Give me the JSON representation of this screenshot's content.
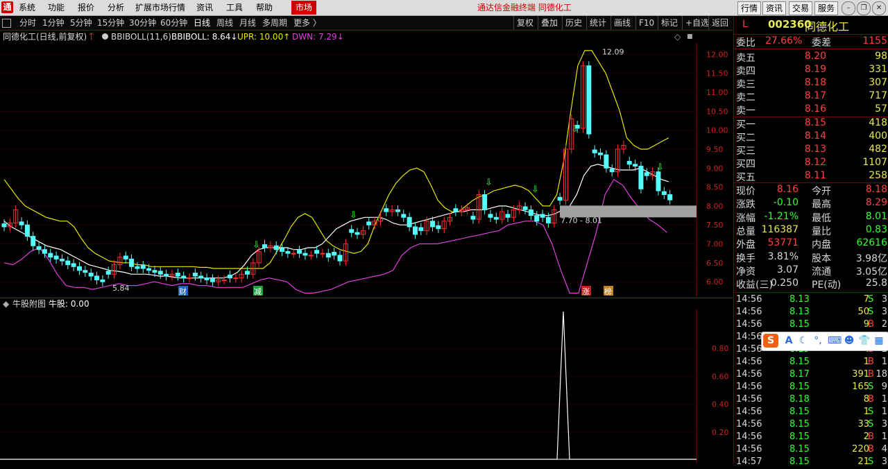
{
  "menu": {
    "logo": "通",
    "items": [
      "系统",
      "功能",
      "报价",
      "分析",
      "扩展市场行情",
      "资讯",
      "工具",
      "帮助"
    ],
    "market_btn": "市场",
    "title": "通达信金融终端  同德化工",
    "right_buttons": [
      "行情",
      "资讯",
      "交易",
      "服务"
    ]
  },
  "periods": [
    "分时",
    "1分钟",
    "5分钟",
    "15分钟",
    "30分钟",
    "60分钟",
    "日线",
    "周线",
    "月线",
    "多周期",
    "更多 〉"
  ],
  "active_period": "日线",
  "tools": [
    "复权",
    "叠加",
    "历史",
    "统计",
    "画线",
    "F10",
    "标记",
    "+自选",
    "返回"
  ],
  "info": {
    "name": "同德化工(日线,前复权)",
    "indicator": "BBIBOLL(11,6)",
    "bbiboll": "BBIBOLL: 8.64↓",
    "upr": "UPR: 10.00↑",
    "dwn": "DWN: 7.29↓"
  },
  "sub_info": {
    "name": "牛股附图",
    "value": "牛股: 0.00"
  },
  "chart_labels": {
    "high": "12.09",
    "low": "5.84",
    "range": "7.70 - 8.01"
  },
  "markers": [
    "财",
    "减",
    "涨",
    "榜"
  ],
  "colors": {
    "up": "#ff3030",
    "down": "#54fcfc",
    "upr": "#e8e800",
    "mid": "#ffffff",
    "dwn": "#e040e0",
    "grid": "#700000"
  },
  "chart_data": {
    "type": "candlestick",
    "title": "同德化工(日线,前复权)",
    "ylim": [
      5.6,
      12.3
    ],
    "y_ticks": [
      "6.00",
      "6.50",
      "7.00",
      "7.50",
      "8.00",
      "8.50",
      "9.00",
      "9.50",
      "10.00",
      "10.50",
      "11.00",
      "11.50",
      "12.00"
    ],
    "sub_ticks": [
      "0.20",
      "0.40",
      "0.60",
      "0.80"
    ],
    "sub_ylim": [
      0,
      1.0
    ],
    "closes": [
      7.45,
      7.55,
      7.9,
      7.5,
      7.2,
      6.95,
      6.85,
      6.75,
      6.65,
      6.6,
      6.55,
      6.45,
      6.4,
      6.3,
      6.25,
      6.15,
      6.05,
      6.0,
      6.2,
      6.45,
      6.65,
      6.6,
      6.4,
      6.35,
      6.35,
      6.3,
      6.25,
      6.2,
      6.15,
      6.2,
      6.15,
      6.1,
      6.1,
      6.15,
      6.1,
      6.05,
      6.0,
      6.05,
      6.05,
      6.1,
      6.1,
      6.2,
      6.2,
      6.5,
      6.8,
      6.9,
      6.95,
      6.85,
      6.8,
      6.75,
      6.75,
      6.75,
      6.7,
      6.7,
      6.75,
      6.75,
      6.65,
      6.7,
      6.55,
      7.0,
      7.3,
      7.25,
      7.35,
      7.5,
      7.6,
      7.7,
      7.85,
      7.9,
      7.85,
      7.7,
      7.45,
      7.25,
      7.35,
      7.6,
      7.45,
      7.4,
      7.6,
      7.7,
      7.85,
      7.9,
      7.95,
      7.65,
      8.3,
      7.9,
      7.7,
      7.65,
      7.85,
      7.7,
      7.9,
      8.0,
      7.9,
      7.75,
      7.6,
      7.7,
      7.55,
      7.9,
      8.15,
      9.5,
      10.3,
      10.05,
      11.7,
      9.9,
      9.4,
      9.35,
      9.0,
      8.9,
      9.5,
      9.6,
      9.1,
      9.05,
      8.45,
      8.8,
      8.9,
      8.4,
      8.3,
      8.16
    ],
    "upr_line": [
      8.7,
      8.45,
      8.2,
      8.0,
      7.9,
      7.8,
      7.7,
      7.65,
      7.6,
      7.6,
      7.45,
      7.15,
      6.9,
      6.75,
      6.65,
      6.55,
      6.52,
      6.5,
      6.5,
      6.45,
      6.45,
      6.4,
      6.4,
      6.4,
      6.4,
      6.4,
      6.4,
      6.4,
      6.38,
      6.38,
      6.35,
      6.35,
      6.35,
      6.35,
      6.35,
      6.35,
      6.35,
      6.35,
      6.5,
      6.8,
      7.1,
      7.45,
      7.7,
      7.8,
      7.7,
      7.4,
      7.1,
      6.95,
      6.85,
      6.8,
      6.75,
      6.8,
      7.0,
      7.5,
      7.9,
      8.3,
      8.6,
      8.8,
      8.95,
      9.0,
      8.9,
      8.55,
      8.15,
      7.95,
      7.85,
      7.85,
      8.0,
      8.15,
      8.25,
      8.3,
      8.4,
      8.45,
      8.5,
      8.55,
      8.5,
      8.4,
      8.2,
      8.0,
      8.0,
      8.3,
      9.2,
      10.5,
      11.7,
      12.1,
      12.1,
      11.8,
      11.5,
      11.0,
      10.5,
      9.8,
      9.6,
      9.5,
      9.5,
      9.6,
      9.7,
      9.8
    ],
    "mid_line": [
      7.6,
      7.45,
      7.35,
      7.25,
      7.15,
      7.05,
      6.95,
      6.9,
      6.85,
      6.75,
      6.65,
      6.55,
      6.45,
      6.4,
      6.35,
      6.3,
      6.28,
      6.25,
      6.2,
      6.2,
      6.2,
      6.18,
      6.15,
      6.15,
      6.12,
      6.1,
      6.1,
      6.1,
      6.1,
      6.1,
      6.1,
      6.1,
      6.15,
      6.25,
      6.45,
      6.7,
      6.85,
      6.9,
      6.9,
      6.9,
      6.9,
      6.85,
      6.85,
      6.9,
      6.9,
      7.0,
      7.2,
      7.4,
      7.5,
      7.6,
      7.65,
      7.7,
      7.7,
      7.7,
      7.65,
      7.55,
      7.5,
      7.5,
      7.55,
      7.6,
      7.65,
      7.7,
      7.75,
      7.8,
      7.85,
      7.85,
      7.9,
      7.9,
      7.9,
      7.95,
      8.0,
      8.0,
      7.95,
      7.9,
      7.85,
      7.8,
      7.75,
      7.75,
      7.8,
      7.9,
      8.0,
      8.3,
      8.8,
      9.05,
      9.1,
      9.05,
      9.0,
      8.95,
      8.95,
      8.95,
      9.0,
      8.9,
      8.8,
      8.7,
      8.64
    ],
    "dwn_line": [
      6.5,
      6.45,
      6.6,
      6.8,
      6.9,
      6.6,
      6.2,
      5.9,
      5.85,
      5.85,
      5.8,
      5.85,
      5.9,
      5.95,
      5.9,
      5.9,
      5.95,
      6.0,
      5.95,
      5.9,
      5.95,
      5.95,
      5.9,
      5.9,
      5.85,
      5.85,
      5.85,
      5.85,
      5.95,
      6.05,
      6.1,
      6.05,
      6.0,
      5.8,
      5.7,
      5.7,
      5.75,
      5.8,
      5.9,
      6.0,
      6.05,
      6.1,
      6.15,
      6.2,
      6.3,
      6.7,
      6.9,
      7.0,
      7.0,
      7.0,
      7.05,
      7.1,
      7.15,
      7.2,
      7.25,
      7.3,
      7.35,
      7.5,
      7.55,
      7.6,
      7.6,
      7.5,
      7.0,
      6.3,
      5.7,
      5.7,
      6.5,
      7.3,
      8.3,
      8.7,
      8.55,
      8.2,
      7.9,
      7.65,
      7.5,
      7.3
    ]
  },
  "quote": {
    "header_label": "L",
    "code": "002360",
    "name": "同德化工",
    "weibi_label": "委比",
    "weibi": "27.66%",
    "weicha_label": "委差",
    "weicha": "1155",
    "asks": [
      {
        "label": "卖五",
        "price": "8.20",
        "vol": "98"
      },
      {
        "label": "卖四",
        "price": "8.19",
        "vol": "331"
      },
      {
        "label": "卖三",
        "price": "8.18",
        "vol": "307"
      },
      {
        "label": "卖二",
        "price": "8.17",
        "vol": "717"
      },
      {
        "label": "卖一",
        "price": "8.16",
        "vol": "57"
      }
    ],
    "bids": [
      {
        "label": "买一",
        "price": "8.15",
        "vol": "418"
      },
      {
        "label": "买二",
        "price": "8.14",
        "vol": "400"
      },
      {
        "label": "买三",
        "price": "8.13",
        "vol": "482"
      },
      {
        "label": "买四",
        "price": "8.12",
        "vol": "1107"
      },
      {
        "label": "买五",
        "price": "8.11",
        "vol": "258"
      }
    ],
    "stats": [
      {
        "l1": "现价",
        "v1": "8.16",
        "c1": "#ff4040",
        "l2": "今开",
        "v2": "8.18",
        "c2": "#ff4040"
      },
      {
        "l1": "涨跌",
        "v1": "-0.10",
        "c1": "#30ff30",
        "l2": "最高",
        "v2": "8.29",
        "c2": "#ff4040"
      },
      {
        "l1": "涨幅",
        "v1": "-1.21%",
        "c1": "#30ff30",
        "l2": "最低",
        "v2": "8.01",
        "c2": "#30ff30"
      },
      {
        "l1": "总量",
        "v1": "116387",
        "c1": "#e8e850",
        "l2": "量比",
        "v2": "0.83",
        "c2": "#30ff30"
      },
      {
        "l1": "外盘",
        "v1": "53771",
        "c1": "#ff4040",
        "l2": "内盘",
        "v2": "62616",
        "c2": "#30ff30"
      },
      {
        "l1": "换手",
        "v1": "3.81%",
        "c1": "#d8d8d8",
        "l2": "股本",
        "v2": "3.98亿",
        "c2": "#d8d8d8"
      },
      {
        "l1": "净资",
        "v1": "3.07",
        "c1": "#d8d8d8",
        "l2": "流通",
        "v2": "3.05亿",
        "c2": "#d8d8d8"
      },
      {
        "l1": "收益(三)",
        "v1": "0.250",
        "c1": "#d8d8d8",
        "l2": "PE(动)",
        "v2": "25.8",
        "c2": "#d8d8d8"
      }
    ],
    "trades": [
      {
        "time": "14:56",
        "price": "8.13",
        "vol": "7",
        "side": "S",
        "num": "3"
      },
      {
        "time": "14:56",
        "price": "8.13",
        "vol": "50",
        "side": "S",
        "num": "3"
      },
      {
        "time": "14:56",
        "price": "8.15",
        "vol": "9",
        "side": "B",
        "num": "2"
      },
      {
        "time": "14:56",
        "price": "",
        "vol": "",
        "side": "",
        "num": ""
      },
      {
        "time": "14:56",
        "price": "8.15",
        "vol": "4",
        "side": "B",
        "num": "2"
      },
      {
        "time": "14:56",
        "price": "8.15",
        "vol": "1",
        "side": "B",
        "num": "1"
      },
      {
        "time": "14:56",
        "price": "8.17",
        "vol": "391",
        "side": "B",
        "num": "18"
      },
      {
        "time": "14:56",
        "price": "8.15",
        "vol": "165",
        "side": "S",
        "num": "9"
      },
      {
        "time": "14:56",
        "price": "8.18",
        "vol": "8",
        "side": "B",
        "num": "1"
      },
      {
        "time": "14:56",
        "price": "8.15",
        "vol": "1",
        "side": "S",
        "num": "1"
      },
      {
        "time": "14:56",
        "price": "8.15",
        "vol": "33",
        "side": "S",
        "num": "3"
      },
      {
        "time": "14:56",
        "price": "8.15",
        "vol": "2",
        "side": "B",
        "num": "1"
      },
      {
        "time": "14:56",
        "price": "8.15",
        "vol": "220",
        "side": "B",
        "num": "4"
      },
      {
        "time": "14:57",
        "price": "8.15",
        "vol": "21",
        "side": "S",
        "num": "3"
      }
    ]
  },
  "ime": {
    "logo": "S",
    "icons": [
      "A-icon",
      "moon-icon",
      "dots-icon",
      "keyboard-icon",
      "user-icon",
      "shirt-icon",
      "grid-icon"
    ]
  }
}
